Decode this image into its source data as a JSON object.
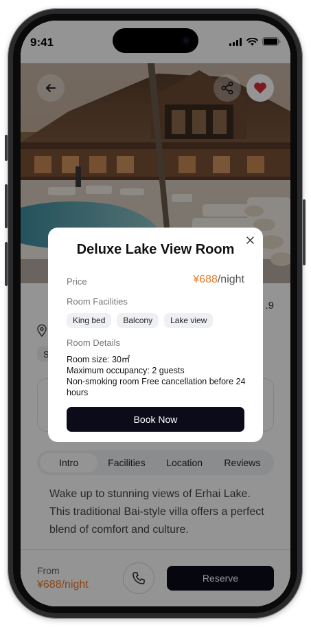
{
  "status_bar": {
    "time": "9:41"
  },
  "header": {
    "back_icon": "arrow-left-icon",
    "share_icon": "share-icon",
    "favorite_icon": "heart-icon",
    "favorite_color": "#d62d3c"
  },
  "listing": {
    "rating_partial": ".9",
    "chip_partial": "S",
    "tabs": [
      "Intro",
      "Facilities",
      "Location",
      "Reviews"
    ],
    "active_tab": "Intro",
    "intro_text": "Wake up to stunning views of Erhai Lake. This traditional Bai-style villa offers a perfect blend of comfort and culture."
  },
  "bottom_bar": {
    "from_label": "From",
    "from_price": "¥688/night",
    "reserve_label": "Reserve",
    "phone_icon": "phone-icon"
  },
  "modal": {
    "title": "Deluxe Lake View Room",
    "close_icon": "close-icon",
    "price_label": "Price",
    "price_amount": "¥688",
    "price_unit": "/night",
    "facilities_label": "Room Facilities",
    "facilities": [
      "King bed",
      "Balcony",
      "Lake view"
    ],
    "details_label": "Room Details",
    "details": [
      "Room size: 30㎡",
      "Maximum occupancy: 2 guests",
      "Non-smoking room Free cancellation before 24 hours"
    ],
    "book_label": "Book Now"
  },
  "colors": {
    "accent": "#e8792b",
    "primary_button": "#0b0b1a"
  }
}
